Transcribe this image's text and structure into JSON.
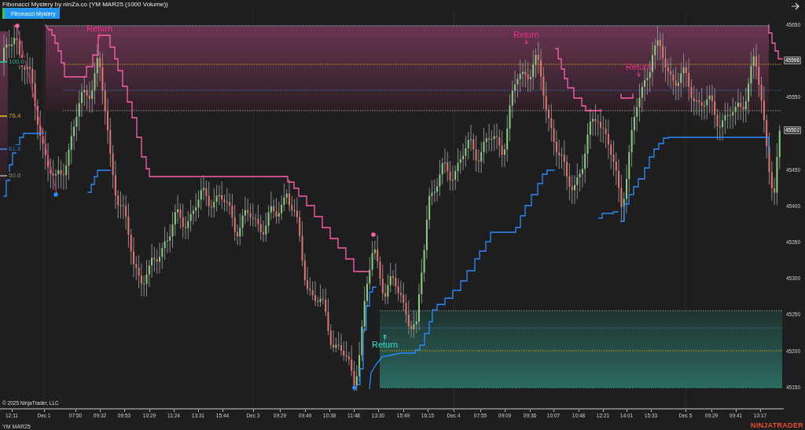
{
  "window": {
    "title": "Fibonacci Mystery by ninZa.co (YM MAR25 (1000 Volume))"
  },
  "indicator_button": {
    "label": "Fibonacci Mystery"
  },
  "fib_levels": [
    {
      "label": "100.0",
      "color": "#2bb39a"
    },
    {
      "label": "76.4",
      "color": "#c8a020"
    },
    {
      "label": "61.8",
      "color": "#3a6fb8"
    },
    {
      "label": "50.0",
      "color": "#8a8a8a"
    }
  ],
  "signals": [
    {
      "label": "Return",
      "kind": "sell"
    },
    {
      "label": "Return",
      "kind": "sell"
    },
    {
      "label": "Return",
      "kind": "sell"
    },
    {
      "label": "Return",
      "kind": "buy"
    }
  ],
  "copyright": "© 2025 NinjaTrader, LLC",
  "price_axis": {
    "labels": [
      "45650",
      "45550",
      "45450",
      "45400",
      "45350",
      "45300",
      "45250",
      "45200",
      "45150"
    ],
    "tags": [
      "45596",
      "45502"
    ]
  },
  "time_axis": {
    "labels": [
      "12:11",
      "Dec 1",
      "07:50",
      "09:32",
      "09:53",
      "10:29",
      "11:24",
      "13:31",
      "15:44",
      "Dec 3",
      "09:29",
      "09:49",
      "10:38",
      "11:48",
      "13:30",
      "15:49",
      "16:15",
      "Dec 4",
      "07:55",
      "09:09",
      "09:36",
      "10:07",
      "10:48",
      "12:21",
      "14:01",
      "15:33",
      "Dec 5",
      "09:29",
      "09:41",
      "10:17"
    ]
  },
  "instrument": "YM MAR25",
  "brand": "NINJATRADER"
}
